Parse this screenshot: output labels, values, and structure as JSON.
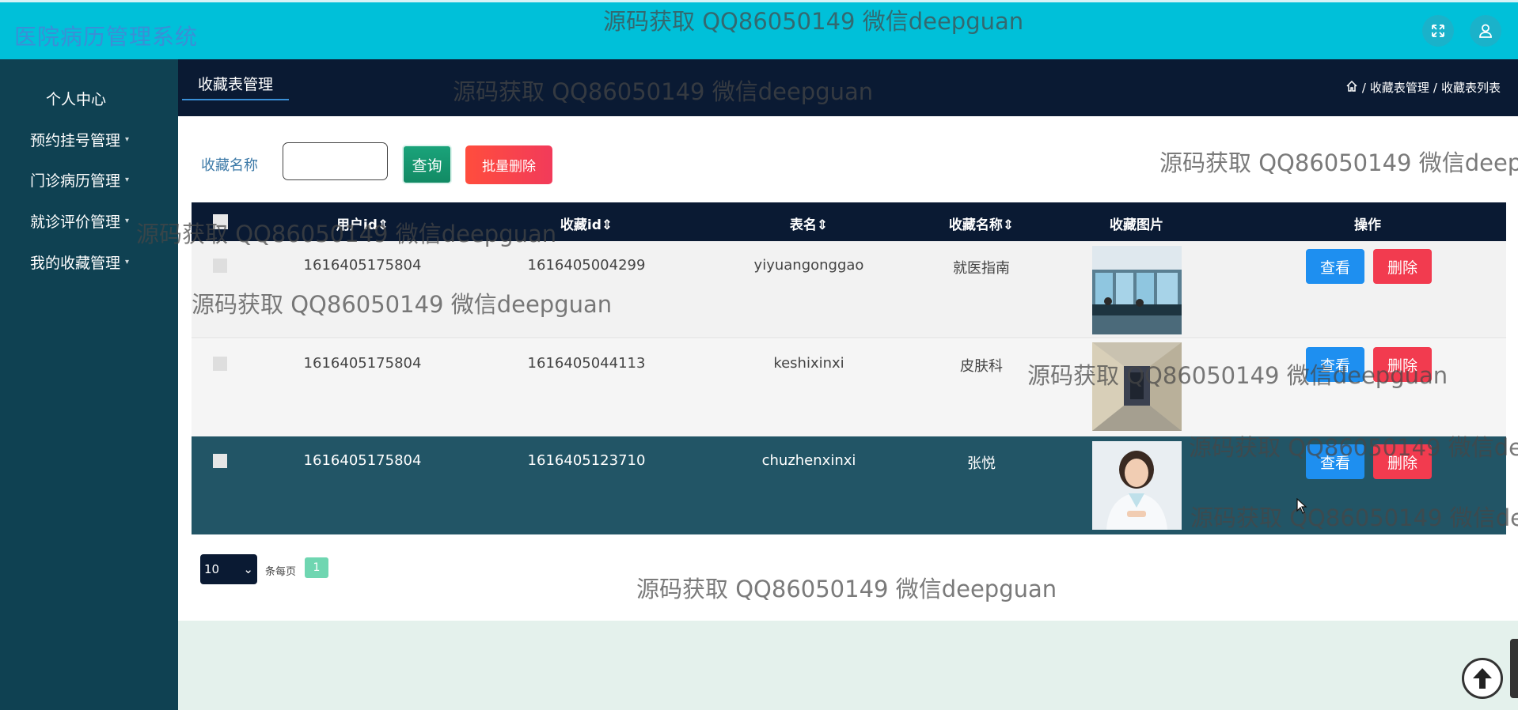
{
  "app": {
    "title": "医院病历管理系统"
  },
  "header": {
    "fullscreen_icon": "expand-icon",
    "user_icon": "user-icon"
  },
  "sidebar": {
    "items": [
      {
        "label": "个人中心",
        "has_caret": false
      },
      {
        "label": "预约挂号管理",
        "has_caret": true
      },
      {
        "label": "门诊病历管理",
        "has_caret": true
      },
      {
        "label": "就诊评价管理",
        "has_caret": true
      },
      {
        "label": "我的收藏管理",
        "has_caret": true
      }
    ]
  },
  "tabs": {
    "active": "收藏表管理"
  },
  "breadcrumb": {
    "home_icon": "home-icon",
    "level1": "收藏表管理",
    "level2": "收藏表列表",
    "separator": "/"
  },
  "search": {
    "label": "收藏名称",
    "value": "",
    "query_button": "查询",
    "batch_delete_button": "批量删除"
  },
  "table": {
    "columns": [
      "用户id",
      "收藏id",
      "表名",
      "收藏名称",
      "收藏图片",
      "操作"
    ],
    "sort_glyph": "⇕",
    "rows": [
      {
        "user_id": "1616405175804",
        "fav_id": "1616405004299",
        "table_name": "yiyuangonggao",
        "fav_name": "就医指南",
        "image": "hospital-counter-photo"
      },
      {
        "user_id": "1616405175804",
        "fav_id": "1616405044113",
        "table_name": "keshixinxi",
        "fav_name": "皮肤科",
        "image": "hospital-corridor-photo"
      },
      {
        "user_id": "1616405175804",
        "fav_id": "1616405123710",
        "table_name": "chuzhenxinxi",
        "fav_name": "张悦",
        "image": "doctor-portrait-photo"
      }
    ],
    "view_label": "查看",
    "delete_label": "删除"
  },
  "pagination": {
    "page_size": "10",
    "per_page_label": "条每页",
    "current_page": "1"
  },
  "watermark": {
    "text": "源码获取 QQ86050149 微信deepguan"
  },
  "colors": {
    "header": "#00c0d9",
    "sidebar": "#0f4152",
    "nav_dark": "#0a1a33",
    "view": "#1e8ff0",
    "delete": "#f23b4f",
    "query": "#1aa37a"
  }
}
